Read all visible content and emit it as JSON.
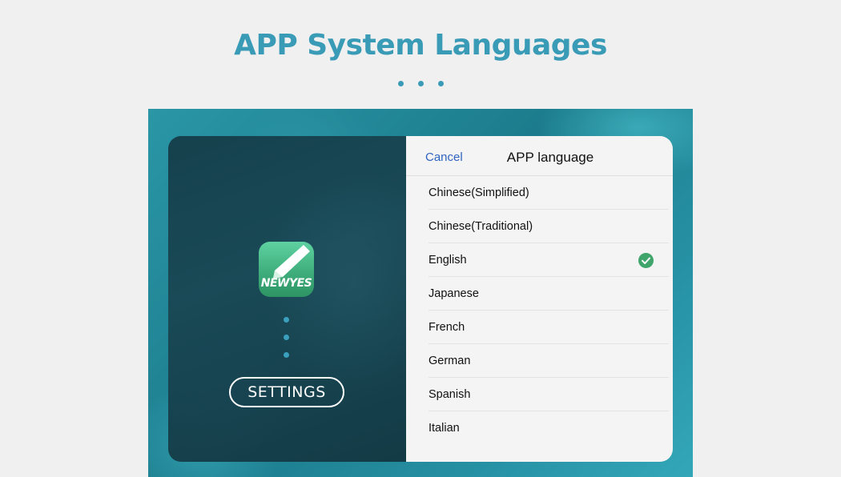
{
  "page": {
    "title": "APP System Languages"
  },
  "app": {
    "icon_text": "NEWYES",
    "settings_label": "SETTINGS"
  },
  "sheet": {
    "cancel_label": "Cancel",
    "title": "APP language",
    "languages": [
      {
        "label": "Chinese(Simplified)",
        "selected": false
      },
      {
        "label": "Chinese(Traditional)",
        "selected": false
      },
      {
        "label": "English",
        "selected": true
      },
      {
        "label": "Japanese",
        "selected": false
      },
      {
        "label": "French",
        "selected": false
      },
      {
        "label": "German",
        "selected": false
      },
      {
        "label": "Spanish",
        "selected": false
      },
      {
        "label": "Italian",
        "selected": false
      }
    ]
  },
  "icons": {
    "selected_marker": "check-circle-icon",
    "app": "pen-icon"
  },
  "colors": {
    "title": "#3a9bb7",
    "cancel": "#2f63c0",
    "check": "#3fa56a",
    "app_icon": "#4cbd8a"
  }
}
